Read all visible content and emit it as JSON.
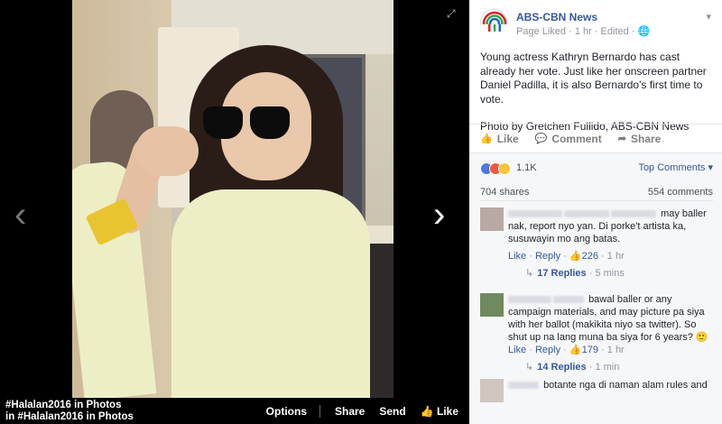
{
  "viewer": {
    "album_line_1": {
      "tag": "#Halalan2016",
      "text": " in Photos"
    },
    "album_line_2": {
      "prefix": "in ",
      "tag": "#Halalan2016",
      "text": " in Photos"
    },
    "actions": {
      "options": "Options",
      "share": "Share",
      "send": "Send",
      "like": "Like"
    },
    "prev_glyph": "‹",
    "next_glyph": "›",
    "expand_glyph": "⤢"
  },
  "post": {
    "page_name": "ABS-CBN News",
    "meta": "Page Liked · 1 hr · Edited · ",
    "caret": "▾",
    "text_1": "Young actress Kathryn Bernardo has cast already her vote. Just like her onscreen partner Daniel Padilla, it is also Bernardo's first time to vote.",
    "text_2": "Photo by Gretchen Fullido, ABS-CBN News",
    "actions": {
      "like": "Like",
      "comment": "Comment",
      "share": "Share"
    }
  },
  "stats": {
    "reactions_count": "1.1K",
    "top_comments": "Top Comments ▾",
    "shares": "704 shares",
    "comments": "554 comments"
  },
  "comments": [
    {
      "text": "may baller nak, report nyo yan. Di porke't artista ka, susuwayin mo ang batas.",
      "like": "Like",
      "reply": "Reply",
      "likes": "226",
      "time": "1 hr",
      "replies": "17 Replies",
      "replies_time": "5 mins"
    },
    {
      "text": "bawal baller or any campaign materials, and may picture pa siya with her ballot (makikita niyo sa twitter). So shut up na lang muna ba siya for 6 years? 🙂",
      "like": "Like",
      "reply": "Reply",
      "likes": "179",
      "time": "1 hr",
      "replies": "14 Replies",
      "replies_time": "1 min"
    },
    {
      "text": "botante nga di naman alam rules and"
    }
  ],
  "colors": {
    "link": "#365899",
    "meta": "#90949c",
    "text": "#1d2129",
    "panel_bg": "#f6f7f9",
    "logo_red": "#d8232a",
    "logo_green": "#2fa84f",
    "logo_blue": "#1f67b1"
  }
}
